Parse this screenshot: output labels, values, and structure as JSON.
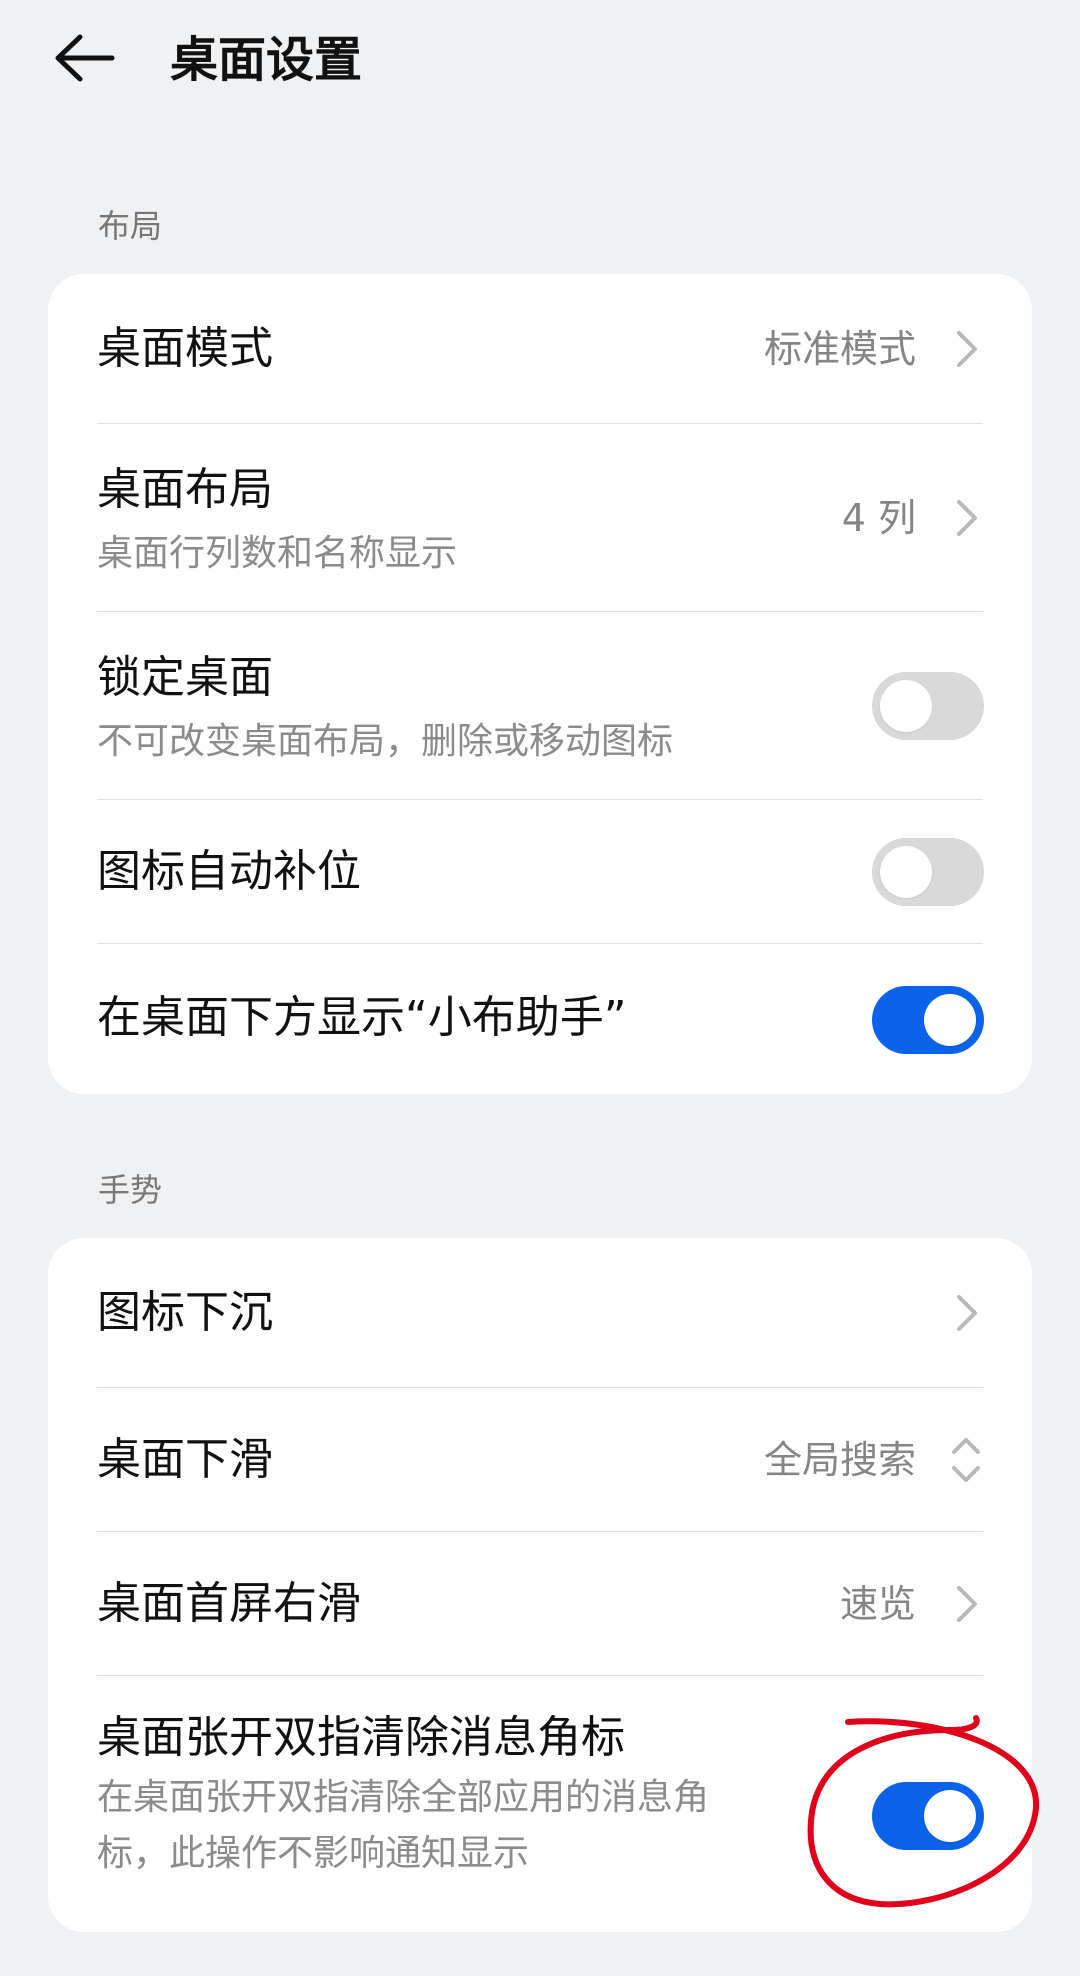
{
  "header": {
    "title": "桌面设置",
    "back_icon": "back-arrow-icon"
  },
  "sections": [
    {
      "label": "布局",
      "rows": [
        {
          "title": "桌面模式",
          "value": "标准模式",
          "control": "chevron"
        },
        {
          "title": "桌面布局",
          "subtitle": "桌面行列数和名称显示",
          "value": "4 列",
          "control": "chevron"
        },
        {
          "title": "锁定桌面",
          "subtitle": "不可改变桌面布局，删除或移动图标",
          "control": "toggle",
          "toggle_state": "off"
        },
        {
          "title": "图标自动补位",
          "control": "toggle",
          "toggle_state": "off"
        },
        {
          "title": "在桌面下方显示“小布助手”",
          "control": "toggle",
          "toggle_state": "on"
        }
      ]
    },
    {
      "label": "手势",
      "rows": [
        {
          "title": "图标下沉",
          "control": "chevron"
        },
        {
          "title": "桌面下滑",
          "value": "全局搜索",
          "control": "updown"
        },
        {
          "title": "桌面首屏右滑",
          "value": "速览",
          "control": "chevron"
        },
        {
          "title": "桌面张开双指清除消息角标",
          "subtitle_line1": "在桌面张开双指清除全部应用的消息角",
          "subtitle_line2": "标，此操作不影响通知显示",
          "control": "toggle",
          "toggle_state": "on"
        }
      ]
    }
  ],
  "colors": {
    "background": "#f0f1f3",
    "card": "#ffffff",
    "toggle_on": "#0a63ea",
    "toggle_off": "#d9d9d9",
    "annotation": "#e0001b"
  }
}
